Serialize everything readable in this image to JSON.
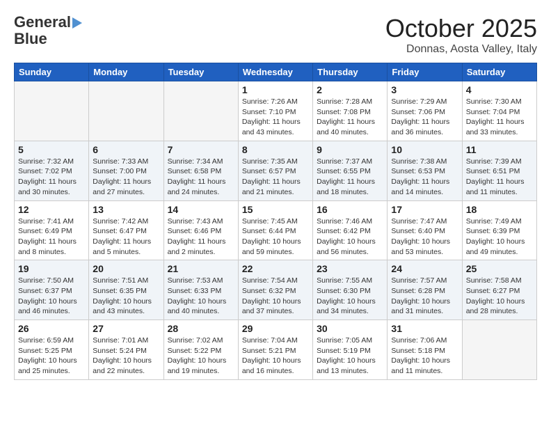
{
  "logo": {
    "line1": "General",
    "line2": "Blue"
  },
  "title": "October 2025",
  "location": "Donnas, Aosta Valley, Italy",
  "weekdays": [
    "Sunday",
    "Monday",
    "Tuesday",
    "Wednesday",
    "Thursday",
    "Friday",
    "Saturday"
  ],
  "weeks": [
    [
      {
        "day": "",
        "info": ""
      },
      {
        "day": "",
        "info": ""
      },
      {
        "day": "",
        "info": ""
      },
      {
        "day": "1",
        "info": "Sunrise: 7:26 AM\nSunset: 7:10 PM\nDaylight: 11 hours and 43 minutes."
      },
      {
        "day": "2",
        "info": "Sunrise: 7:28 AM\nSunset: 7:08 PM\nDaylight: 11 hours and 40 minutes."
      },
      {
        "day": "3",
        "info": "Sunrise: 7:29 AM\nSunset: 7:06 PM\nDaylight: 11 hours and 36 minutes."
      },
      {
        "day": "4",
        "info": "Sunrise: 7:30 AM\nSunset: 7:04 PM\nDaylight: 11 hours and 33 minutes."
      }
    ],
    [
      {
        "day": "5",
        "info": "Sunrise: 7:32 AM\nSunset: 7:02 PM\nDaylight: 11 hours and 30 minutes."
      },
      {
        "day": "6",
        "info": "Sunrise: 7:33 AM\nSunset: 7:00 PM\nDaylight: 11 hours and 27 minutes."
      },
      {
        "day": "7",
        "info": "Sunrise: 7:34 AM\nSunset: 6:58 PM\nDaylight: 11 hours and 24 minutes."
      },
      {
        "day": "8",
        "info": "Sunrise: 7:35 AM\nSunset: 6:57 PM\nDaylight: 11 hours and 21 minutes."
      },
      {
        "day": "9",
        "info": "Sunrise: 7:37 AM\nSunset: 6:55 PM\nDaylight: 11 hours and 18 minutes."
      },
      {
        "day": "10",
        "info": "Sunrise: 7:38 AM\nSunset: 6:53 PM\nDaylight: 11 hours and 14 minutes."
      },
      {
        "day": "11",
        "info": "Sunrise: 7:39 AM\nSunset: 6:51 PM\nDaylight: 11 hours and 11 minutes."
      }
    ],
    [
      {
        "day": "12",
        "info": "Sunrise: 7:41 AM\nSunset: 6:49 PM\nDaylight: 11 hours and 8 minutes."
      },
      {
        "day": "13",
        "info": "Sunrise: 7:42 AM\nSunset: 6:47 PM\nDaylight: 11 hours and 5 minutes."
      },
      {
        "day": "14",
        "info": "Sunrise: 7:43 AM\nSunset: 6:46 PM\nDaylight: 11 hours and 2 minutes."
      },
      {
        "day": "15",
        "info": "Sunrise: 7:45 AM\nSunset: 6:44 PM\nDaylight: 10 hours and 59 minutes."
      },
      {
        "day": "16",
        "info": "Sunrise: 7:46 AM\nSunset: 6:42 PM\nDaylight: 10 hours and 56 minutes."
      },
      {
        "day": "17",
        "info": "Sunrise: 7:47 AM\nSunset: 6:40 PM\nDaylight: 10 hours and 53 minutes."
      },
      {
        "day": "18",
        "info": "Sunrise: 7:49 AM\nSunset: 6:39 PM\nDaylight: 10 hours and 49 minutes."
      }
    ],
    [
      {
        "day": "19",
        "info": "Sunrise: 7:50 AM\nSunset: 6:37 PM\nDaylight: 10 hours and 46 minutes."
      },
      {
        "day": "20",
        "info": "Sunrise: 7:51 AM\nSunset: 6:35 PM\nDaylight: 10 hours and 43 minutes."
      },
      {
        "day": "21",
        "info": "Sunrise: 7:53 AM\nSunset: 6:33 PM\nDaylight: 10 hours and 40 minutes."
      },
      {
        "day": "22",
        "info": "Sunrise: 7:54 AM\nSunset: 6:32 PM\nDaylight: 10 hours and 37 minutes."
      },
      {
        "day": "23",
        "info": "Sunrise: 7:55 AM\nSunset: 6:30 PM\nDaylight: 10 hours and 34 minutes."
      },
      {
        "day": "24",
        "info": "Sunrise: 7:57 AM\nSunset: 6:28 PM\nDaylight: 10 hours and 31 minutes."
      },
      {
        "day": "25",
        "info": "Sunrise: 7:58 AM\nSunset: 6:27 PM\nDaylight: 10 hours and 28 minutes."
      }
    ],
    [
      {
        "day": "26",
        "info": "Sunrise: 6:59 AM\nSunset: 5:25 PM\nDaylight: 10 hours and 25 minutes."
      },
      {
        "day": "27",
        "info": "Sunrise: 7:01 AM\nSunset: 5:24 PM\nDaylight: 10 hours and 22 minutes."
      },
      {
        "day": "28",
        "info": "Sunrise: 7:02 AM\nSunset: 5:22 PM\nDaylight: 10 hours and 19 minutes."
      },
      {
        "day": "29",
        "info": "Sunrise: 7:04 AM\nSunset: 5:21 PM\nDaylight: 10 hours and 16 minutes."
      },
      {
        "day": "30",
        "info": "Sunrise: 7:05 AM\nSunset: 5:19 PM\nDaylight: 10 hours and 13 minutes."
      },
      {
        "day": "31",
        "info": "Sunrise: 7:06 AM\nSunset: 5:18 PM\nDaylight: 10 hours and 11 minutes."
      },
      {
        "day": "",
        "info": ""
      }
    ]
  ]
}
